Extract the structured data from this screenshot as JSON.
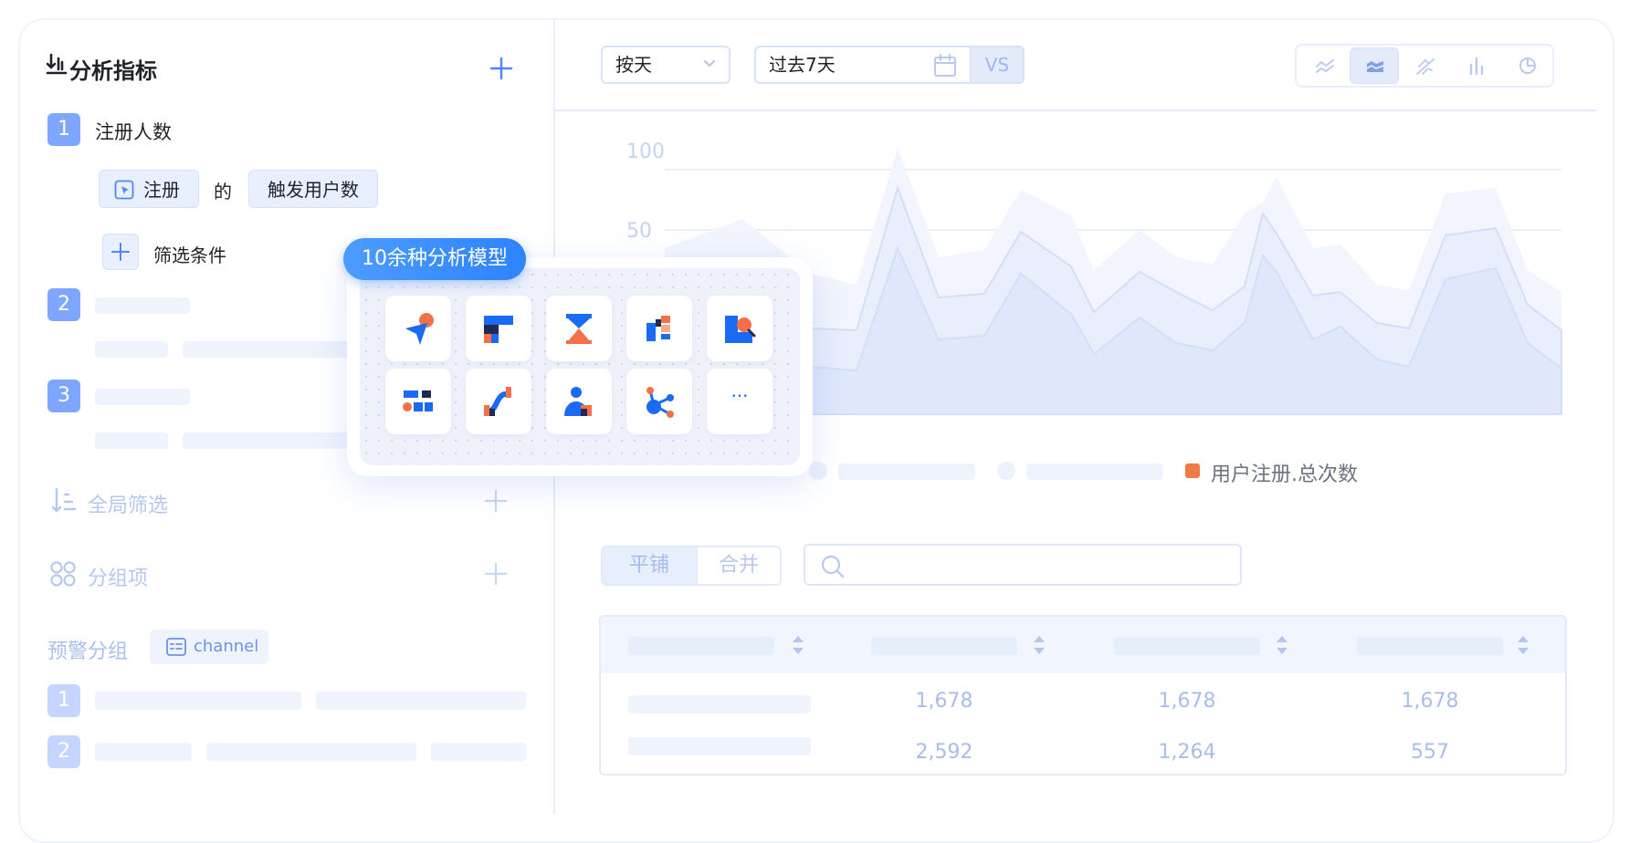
{
  "left_panel": {
    "title": "分析指标",
    "metric1": {
      "index": "1",
      "name": "注册人数",
      "event_chip": "注册",
      "connector": "的",
      "measure_chip": "触发用户数",
      "filter_label": "筛选条件"
    },
    "metric2_index": "2",
    "metric3_index": "3",
    "global_filter_label": "全局筛选",
    "group_by_label": "分组项",
    "alert_group_label": "预警分组",
    "alert_group_chip": "channel",
    "alert_rows": [
      "1",
      "2"
    ]
  },
  "popup": {
    "tag": "10余种分析模型",
    "more_label": "···",
    "models": [
      "path-icon",
      "funnel-icon",
      "retention-icon",
      "distribution-icon",
      "attribution-icon",
      "segment-icon",
      "interval-icon",
      "user-icon",
      "network-icon",
      "more-icon"
    ]
  },
  "toolbar": {
    "granularity": "按天",
    "date_range": "过去7天",
    "compare_label": "VS",
    "chart_types": [
      "line-chart",
      "area-chart",
      "stacked-chart",
      "bar-chart",
      "pie-chart"
    ],
    "active_chart_type": "area-chart"
  },
  "chart_data": {
    "type": "area",
    "yticks": [
      "100",
      "50"
    ],
    "legend": [
      "用户注册.总次数"
    ],
    "legend_color": "#f07a45"
  },
  "table_controls": {
    "tab_tile": "平铺",
    "tab_merge": "合并",
    "search_placeholder": ""
  },
  "table": {
    "rows": [
      [
        "1,678",
        "1,678",
        "1,678"
      ],
      [
        "2,592",
        "1,264",
        "557"
      ]
    ]
  },
  "colors": {
    "accent": "#4f86ff",
    "badge": "#7fa6ff",
    "orange": "#f07a45"
  }
}
